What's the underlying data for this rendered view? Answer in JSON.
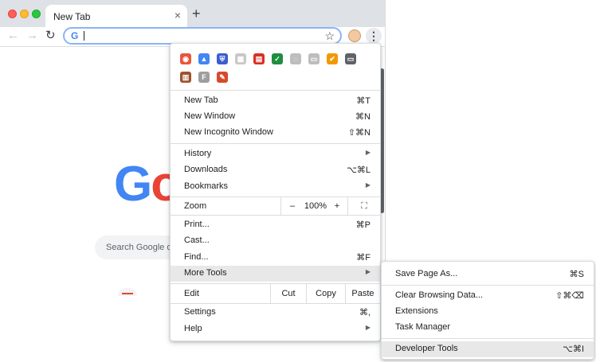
{
  "tab": {
    "title": "New Tab",
    "close": "×",
    "new": "+"
  },
  "toolbar": {
    "back": "←",
    "forward": "→",
    "reload": "↻",
    "omni_g": "G",
    "star": "☆",
    "kebab": "⋮"
  },
  "page": {
    "logo_g": "G",
    "logo_o": "o",
    "search_placeholder": "Search Google or"
  },
  "extensions": [
    {
      "name": "ext-1",
      "color": "#e8563c",
      "glyph": "◉"
    },
    {
      "name": "ext-2",
      "color": "#4285f4",
      "glyph": "▲"
    },
    {
      "name": "ext-3",
      "color": "#3a5fcd",
      "glyph": "⛨"
    },
    {
      "name": "ext-4",
      "color": "#c8c8c8",
      "glyph": "▦"
    },
    {
      "name": "ext-5",
      "color": "#d93025",
      "glyph": "▤"
    },
    {
      "name": "ext-6",
      "color": "#1e8e3e",
      "glyph": "✓"
    },
    {
      "name": "ext-7",
      "color": "#bdbdbd",
      "glyph": "◌"
    },
    {
      "name": "ext-8",
      "color": "#bdbdbd",
      "glyph": "▭"
    },
    {
      "name": "ext-9",
      "color": "#f29900",
      "glyph": "✔"
    },
    {
      "name": "ext-10",
      "color": "#5f6368",
      "glyph": "▭"
    },
    {
      "name": "ext-11",
      "color": "#a0522d",
      "glyph": "▥"
    },
    {
      "name": "ext-12",
      "color": "#9e9e9e",
      "glyph": "F"
    },
    {
      "name": "ext-13",
      "color": "#d64a2b",
      "glyph": "✎"
    }
  ],
  "menu": {
    "new_tab": {
      "label": "New Tab",
      "shortcut": "⌘T"
    },
    "new_window": {
      "label": "New Window",
      "shortcut": "⌘N"
    },
    "incognito": {
      "label": "New Incognito Window",
      "shortcut": "⇧⌘N"
    },
    "history": {
      "label": "History",
      "arrow": "▶"
    },
    "downloads": {
      "label": "Downloads",
      "shortcut": "⌥⌘L"
    },
    "bookmarks": {
      "label": "Bookmarks",
      "arrow": "▶"
    },
    "zoom": {
      "label": "Zoom",
      "minus": "–",
      "value": "100%",
      "plus": "+",
      "fullscreen": "⛶"
    },
    "print": {
      "label": "Print...",
      "shortcut": "⌘P"
    },
    "cast": {
      "label": "Cast..."
    },
    "find": {
      "label": "Find...",
      "shortcut": "⌘F"
    },
    "more_tools": {
      "label": "More Tools",
      "arrow": "▶"
    },
    "edit": {
      "label": "Edit",
      "cut": "Cut",
      "copy": "Copy",
      "paste": "Paste"
    },
    "settings": {
      "label": "Settings",
      "shortcut": "⌘,"
    },
    "help": {
      "label": "Help",
      "arrow": "▶"
    }
  },
  "submenu": {
    "save_page": {
      "label": "Save Page As...",
      "shortcut": "⌘S"
    },
    "clear_data": {
      "label": "Clear Browsing Data...",
      "shortcut": "⇧⌘⌫"
    },
    "extensions": {
      "label": "Extensions"
    },
    "task_manager": {
      "label": "Task Manager"
    },
    "dev_tools": {
      "label": "Developer Tools",
      "shortcut": "⌥⌘I"
    }
  }
}
